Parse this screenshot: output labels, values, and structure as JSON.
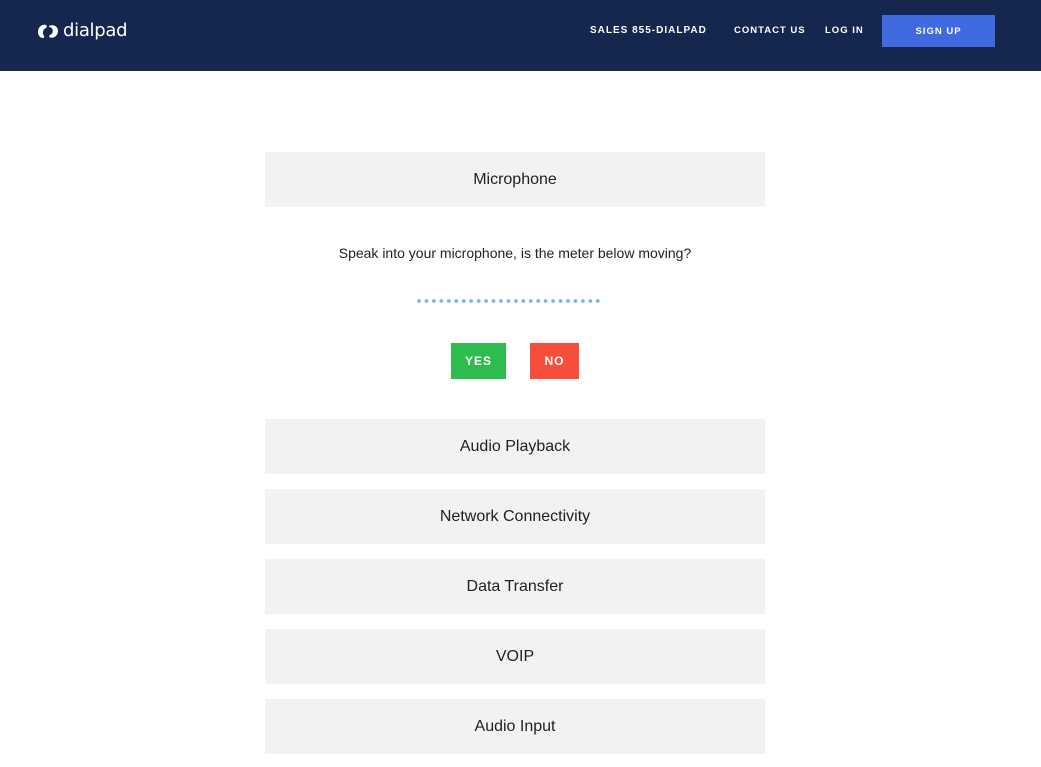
{
  "header": {
    "logo_text": "dialpad",
    "nav": {
      "sales": "SALES 855-DIALPAD",
      "contact": "CONTACT US",
      "login": "LOG IN",
      "signup": "SIGN UP"
    },
    "colors": {
      "background": "#16274f",
      "signup_button": "#3f6ae0"
    }
  },
  "main": {
    "active_section": "Microphone",
    "prompt": "Speak into your microphone, is the meter below moving?",
    "meter": {
      "dot_count": 25,
      "active_dots": 0,
      "color": "#7fb2ea"
    },
    "buttons": {
      "yes": "YES",
      "no": "NO"
    },
    "sections": [
      "Audio Playback",
      "Network Connectivity",
      "Data Transfer",
      "VOIP",
      "Audio Input"
    ],
    "colors": {
      "panel": "#f2f2f2",
      "yes": "#2ebd4c",
      "no": "#f54f3c"
    }
  }
}
